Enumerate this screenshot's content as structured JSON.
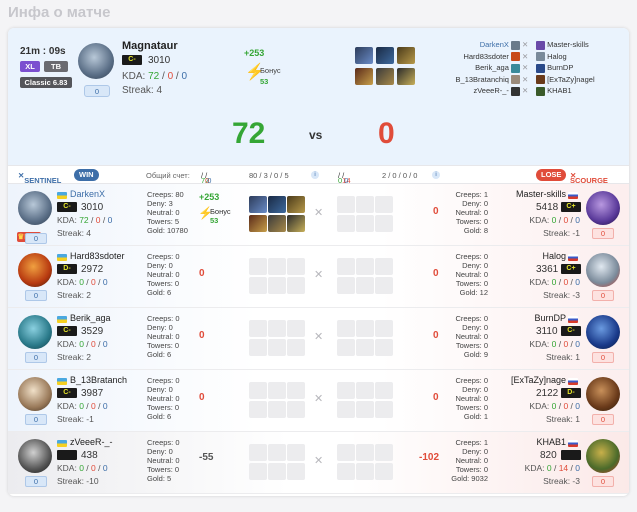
{
  "page_title": "Инфа о матче",
  "summary": {
    "duration": "21m : 09s",
    "tags": [
      "XL",
      "TB"
    ],
    "mode": "Classic 6.83",
    "player": {
      "name": "Magnataur",
      "rank": "C-",
      "mmr": "3010",
      "kda_label": "KDA:",
      "kda": [
        "72",
        "0",
        "0"
      ],
      "streak": "Streak: 4",
      "counter": "0"
    },
    "gain": "+253",
    "bonus_label": "Бонус",
    "bonus_value": "53",
    "score_sentinel": "72",
    "vs": "vs",
    "score_scourge": "0",
    "team_sentinel": [
      "DarkenX",
      "Hard83sdoter",
      "Berik_aga",
      "B_13Bratanchiq",
      "zVeeeR-_-"
    ],
    "team_scourge": [
      "Master-skills",
      "Halog",
      "BurnDP",
      "[ExTaZy]nagel",
      "KHAB1"
    ]
  },
  "header": {
    "sentinel": "SENTINEL",
    "win": "WIN",
    "total_label": "Общий счет:",
    "total_left": [
      "72",
      "0",
      "0"
    ],
    "total_mid": "80 / 3 / 0 / 5",
    "total_right": [
      "0",
      "14",
      "0"
    ],
    "total_right_mid": "2 / 0 / 0 / 0",
    "info": "i",
    "lose": "LOSE",
    "scourge": "SCOURGE"
  },
  "rows": [
    {
      "left": {
        "name": "DarkenX",
        "rank": "C-",
        "mmr": "3010",
        "kda": [
          "72",
          "0",
          "0"
        ],
        "streak": "Streak: 4",
        "counter": "0",
        "mvp": "MVP",
        "stats": [
          "Creeps: 80",
          "Deny: 3",
          "Neutral: 0",
          "Towers: 5",
          "Gold: 10780"
        ],
        "net": "+253",
        "bonus_label": "Бонус",
        "bonus": "53"
      },
      "right": {
        "name": "Master-skills",
        "rank": "C+",
        "mmr": "5418",
        "kda": [
          "0",
          "0",
          "0"
        ],
        "streak": "Streak: -1",
        "counter": "0",
        "stats": [
          "Creeps: 1",
          "Deny: 0",
          "Neutral: 0",
          "Towers: 0",
          "Gold: 8"
        ],
        "net": "0"
      }
    },
    {
      "left": {
        "name": "Hard83sdoter",
        "rank": "D-",
        "mmr": "2972",
        "kda": [
          "0",
          "0",
          "0"
        ],
        "streak": "Streak: 2",
        "counter": "0",
        "stats": [
          "Creeps: 0",
          "Deny: 0",
          "Neutral: 0",
          "Towers: 0",
          "Gold: 6"
        ],
        "net": "0"
      },
      "right": {
        "name": "Halog",
        "rank": "C+",
        "mmr": "3361",
        "kda": [
          "0",
          "0",
          "0"
        ],
        "streak": "Streak: -3",
        "counter": "0",
        "stats": [
          "Creeps: 0",
          "Deny: 0",
          "Neutral: 0",
          "Towers: 0",
          "Gold: 12"
        ],
        "net": "0"
      }
    },
    {
      "left": {
        "name": "Berik_aga",
        "rank": "C-",
        "mmr": "3529",
        "kda": [
          "0",
          "0",
          "0"
        ],
        "streak": "Streak: 2",
        "counter": "0",
        "stats": [
          "Creeps: 0",
          "Deny: 0",
          "Neutral: 0",
          "Towers: 0",
          "Gold: 6"
        ],
        "net": "0"
      },
      "right": {
        "name": "BurnDP",
        "rank": "C-",
        "mmr": "3110",
        "kda": [
          "0",
          "0",
          "0"
        ],
        "streak": "Streak: 1",
        "counter": "0",
        "stats": [
          "Creeps: 0",
          "Deny: 0",
          "Neutral: 0",
          "Towers: 0",
          "Gold: 9"
        ],
        "net": "0"
      }
    },
    {
      "left": {
        "name": "B_13Bratanch",
        "rank": "C-",
        "mmr": "3987",
        "kda": [
          "0",
          "0",
          "0"
        ],
        "streak": "Streak: -1",
        "counter": "0",
        "stats": [
          "Creeps: 0",
          "Deny: 0",
          "Neutral: 0",
          "Towers: 0",
          "Gold: 6"
        ],
        "net": "0"
      },
      "right": {
        "name": "[ExTaZy]nage",
        "rank": "D-",
        "mmr": "2122",
        "kda": [
          "0",
          "0",
          "0"
        ],
        "streak": "Streak: 1",
        "counter": "0",
        "stats": [
          "Creeps: 0",
          "Deny: 0",
          "Neutral: 0",
          "Towers: 0",
          "Gold: 1"
        ],
        "net": "0"
      }
    },
    {
      "left": {
        "name": "zVeeeR-_-",
        "rank": "",
        "mmr": "438",
        "kda": [
          "0",
          "0",
          "0"
        ],
        "streak": "Streak: -10",
        "counter": "0",
        "stats": [
          "Creeps: 0",
          "Deny: 0",
          "Neutral: 0",
          "Towers: 0",
          "Gold: 5"
        ],
        "net": "-55"
      },
      "right": {
        "name": "KHAB1",
        "rank": "",
        "mmr": "820",
        "kda": [
          "0",
          "14",
          "0"
        ],
        "streak": "Streak: -3",
        "counter": "0",
        "stats": [
          "Creeps: 1",
          "Deny: 0",
          "Neutral: 0",
          "Towers: 0",
          "Gold: 9032"
        ],
        "net": "-102"
      }
    }
  ],
  "colors": {
    "win": "#35a635",
    "lose": "#e04c3a",
    "accent": "#3d6ea8"
  }
}
